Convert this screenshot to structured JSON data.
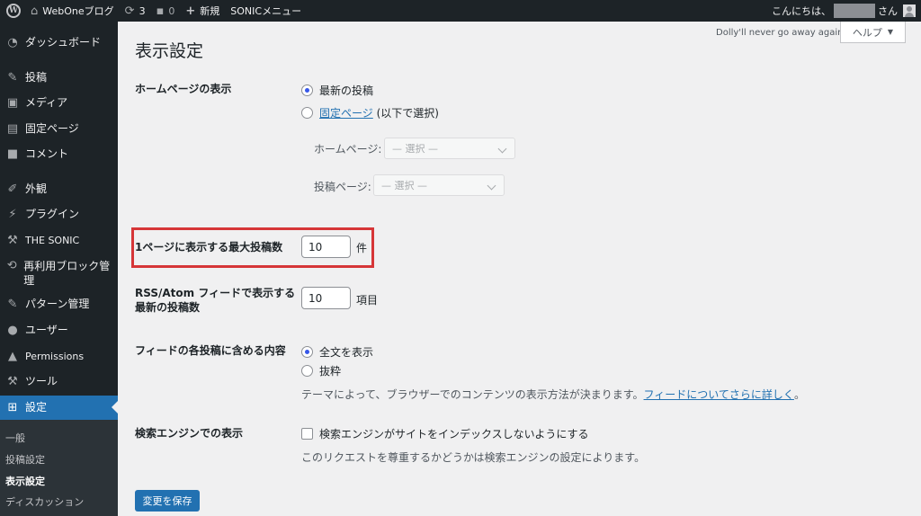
{
  "adminbar": {
    "site_name": "WebOneブログ",
    "updates_count": "3",
    "comments_count": "0",
    "new_label": "新規",
    "sonic_menu": "SONICメニュー",
    "greeting": "こんにちは、",
    "greeting_suffix": "さん"
  },
  "sidebar": {
    "items": [
      {
        "label": "ダッシュボード",
        "icon": "dashboard-icon"
      },
      {
        "label": "投稿",
        "icon": "pin-icon"
      },
      {
        "label": "メディア",
        "icon": "media-icon"
      },
      {
        "label": "固定ページ",
        "icon": "page-icon"
      },
      {
        "label": "コメント",
        "icon": "comment-icon"
      },
      {
        "label": "外観",
        "icon": "brush-icon"
      },
      {
        "label": "プラグイン",
        "icon": "plugin-icon"
      },
      {
        "label": "THE SONIC",
        "icon": "wrench-icon"
      },
      {
        "label": "再利用ブロック管理",
        "icon": "sync-icon"
      },
      {
        "label": "パターン管理",
        "icon": "pin-icon"
      },
      {
        "label": "ユーザー",
        "icon": "user-icon"
      },
      {
        "label": "Permissions",
        "icon": "lock-icon"
      },
      {
        "label": "ツール",
        "icon": "wrench-icon"
      },
      {
        "label": "設定",
        "icon": "settings-icon"
      }
    ],
    "submenu": [
      "一般",
      "投稿設定",
      "表示設定",
      "ディスカッション"
    ]
  },
  "header": {
    "title": "表示設定",
    "dolly": "Dolly'll never go away again",
    "help_label": "ヘルプ"
  },
  "homepage": {
    "label": "ホームページの表示",
    "option_latest": "最新の投稿",
    "option_static_link": "固定ページ",
    "option_static_suffix": " (以下で選択)",
    "homepage_label": "ホームページ:",
    "homepage_select": "— 選択 —",
    "posts_page_label": "投稿ページ:",
    "posts_page_select": "— 選択 —"
  },
  "posts_per_page": {
    "label": "1ページに表示する最大投稿数",
    "value": "10",
    "unit": "件"
  },
  "rss": {
    "label_line1": "RSS/Atom フィードで表示する",
    "label_line2": "最新の投稿数",
    "value": "10",
    "unit": "項目"
  },
  "feed": {
    "label": "フィードの各投稿に含める内容",
    "option_full": "全文を表示",
    "option_excerpt": "抜粋",
    "desc": "テーマによって、ブラウザーでのコンテンツの表示方法が決まります。",
    "desc_link": "フィードについてさらに詳しく",
    "desc_end": "。"
  },
  "search": {
    "label": "検索エンジンでの表示",
    "checkbox_label": "検索エンジンがサイトをインデックスしないようにする",
    "desc": "このリクエストを尊重するかどうかは検索エンジンの設定によります。"
  },
  "save_label": "変更を保存"
}
